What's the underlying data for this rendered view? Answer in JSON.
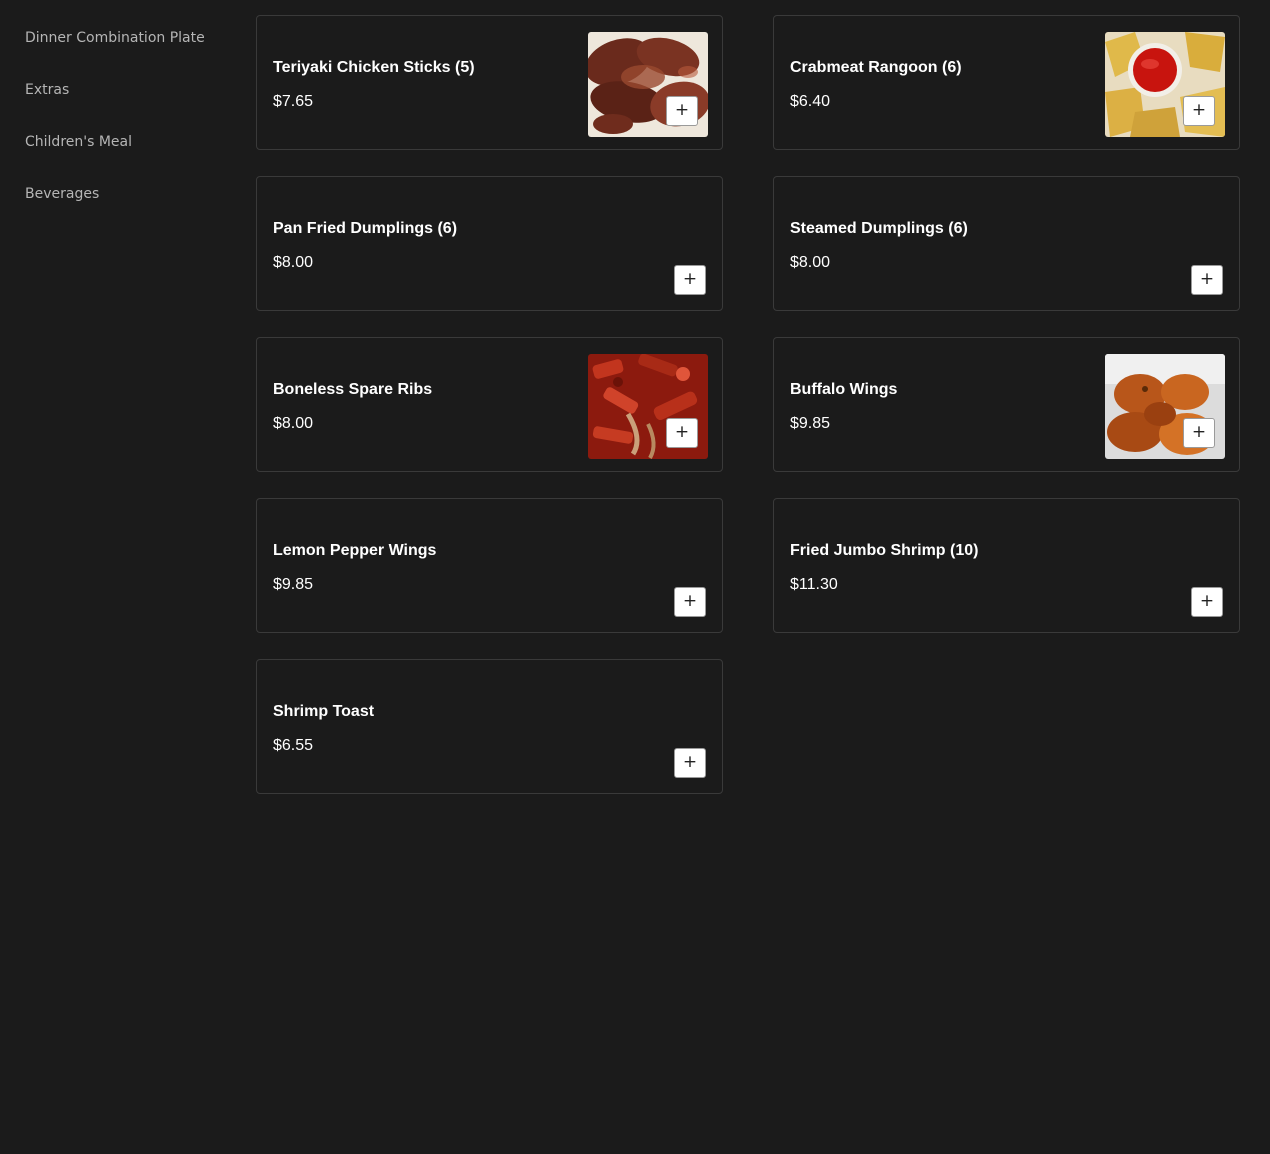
{
  "sidebar": {
    "items": [
      {
        "label": "Dinner Combination Plate"
      },
      {
        "label": "Extras"
      },
      {
        "label": "Children's Meal"
      },
      {
        "label": "Beverages"
      }
    ]
  },
  "menu": {
    "add_label": "+",
    "items": [
      {
        "name": "Teriyaki Chicken Sticks (5)",
        "price": "$7.65",
        "image": "teriyaki-chicken-photo"
      },
      {
        "name": "Crabmeat Rangoon (6)",
        "price": "$6.40",
        "image": "crabmeat-rangoon-photo"
      },
      {
        "name": "Pan Fried Dumplings (6)",
        "price": "$8.00"
      },
      {
        "name": "Steamed Dumplings (6)",
        "price": "$8.00"
      },
      {
        "name": "Boneless Spare Ribs",
        "price": "$8.00",
        "image": "spare-ribs-photo"
      },
      {
        "name": "Buffalo Wings",
        "price": "$9.85",
        "image": "buffalo-wings-photo"
      },
      {
        "name": "Lemon Pepper Wings",
        "price": "$9.85"
      },
      {
        "name": "Fried Jumbo Shrimp (10)",
        "price": "$11.30"
      },
      {
        "name": "Shrimp Toast",
        "price": "$6.55"
      }
    ]
  },
  "colors": {
    "background": "#1b1b1b",
    "card_border": "#3a3a3a",
    "sidebar_text": "#b5b5b5",
    "add_button_bg": "#ffffff"
  }
}
